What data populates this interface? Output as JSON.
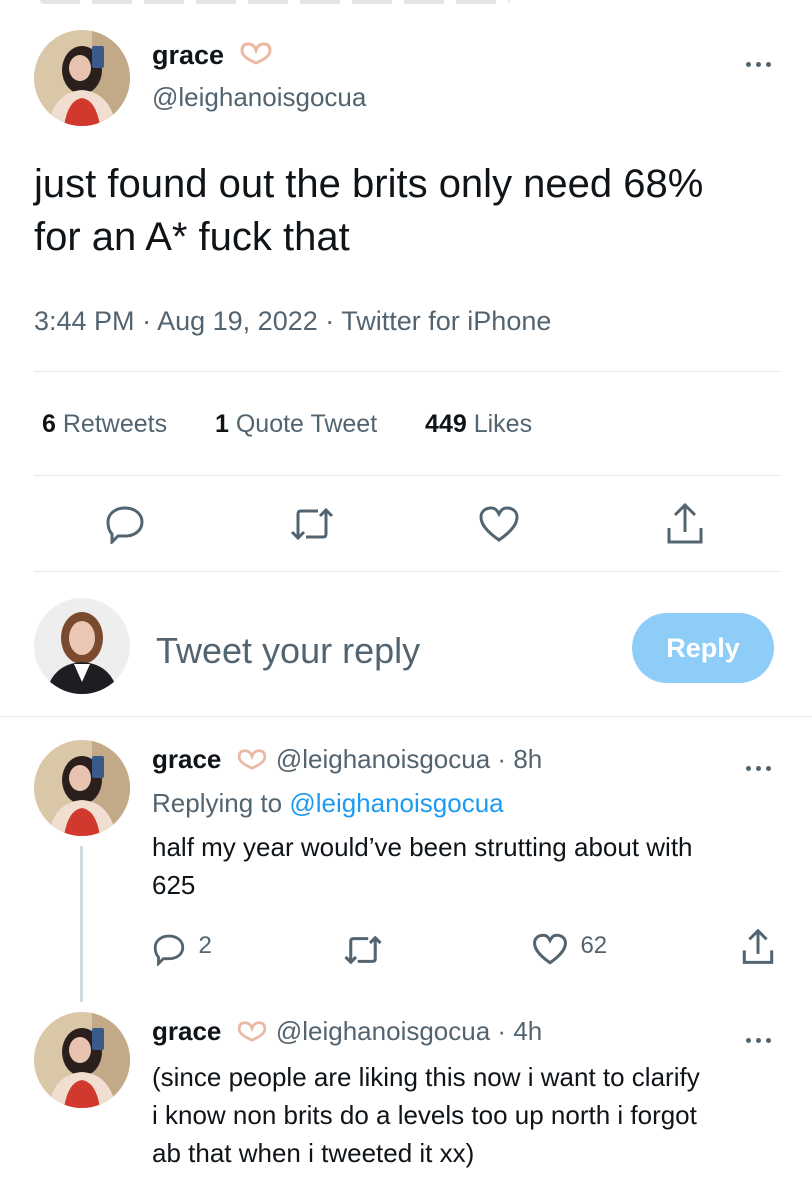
{
  "main_tweet": {
    "author_name": "grace",
    "author_handle": "@leighanoisgocua",
    "text": "just found out the brits only need 68% for an A* fuck that",
    "time": "3:44 PM",
    "date": "Aug 19, 2022",
    "source": "Twitter for iPhone",
    "stats": {
      "retweets_count": "6",
      "retweets_label": "Retweets",
      "quotes_count": "1",
      "quotes_label": "Quote Tweet",
      "likes_count": "449",
      "likes_label": "Likes"
    },
    "actions": [
      "reply-icon",
      "retweet-icon",
      "like-icon",
      "share-icon"
    ]
  },
  "composer": {
    "placeholder": "Tweet your reply",
    "button_label": "Reply",
    "button_color": "#8ecdf7"
  },
  "replies": [
    {
      "author_name": "grace",
      "author_handle": "@leighanoisgocua",
      "age": "8h",
      "replying_to_label": "Replying to",
      "replying_to_handle": "@leighanoisgocua",
      "text_line1": "half my year would’ve been strutting about with",
      "text_line2": "625",
      "reply_count": "2",
      "like_count": "62"
    },
    {
      "author_name": "grace",
      "author_handle": "@leighanoisgocua",
      "age": "4h",
      "text_line1": "(since people are liking this now i want to clarify",
      "text_line2": "i know non brits do a levels too up north i forgot",
      "text_line3": "ab that when i tweeted it xx)"
    }
  ],
  "colors": {
    "accent": "#1d9bf0",
    "muted": "#536471",
    "text": "#0f1419",
    "divider": "#e6e9eb"
  }
}
